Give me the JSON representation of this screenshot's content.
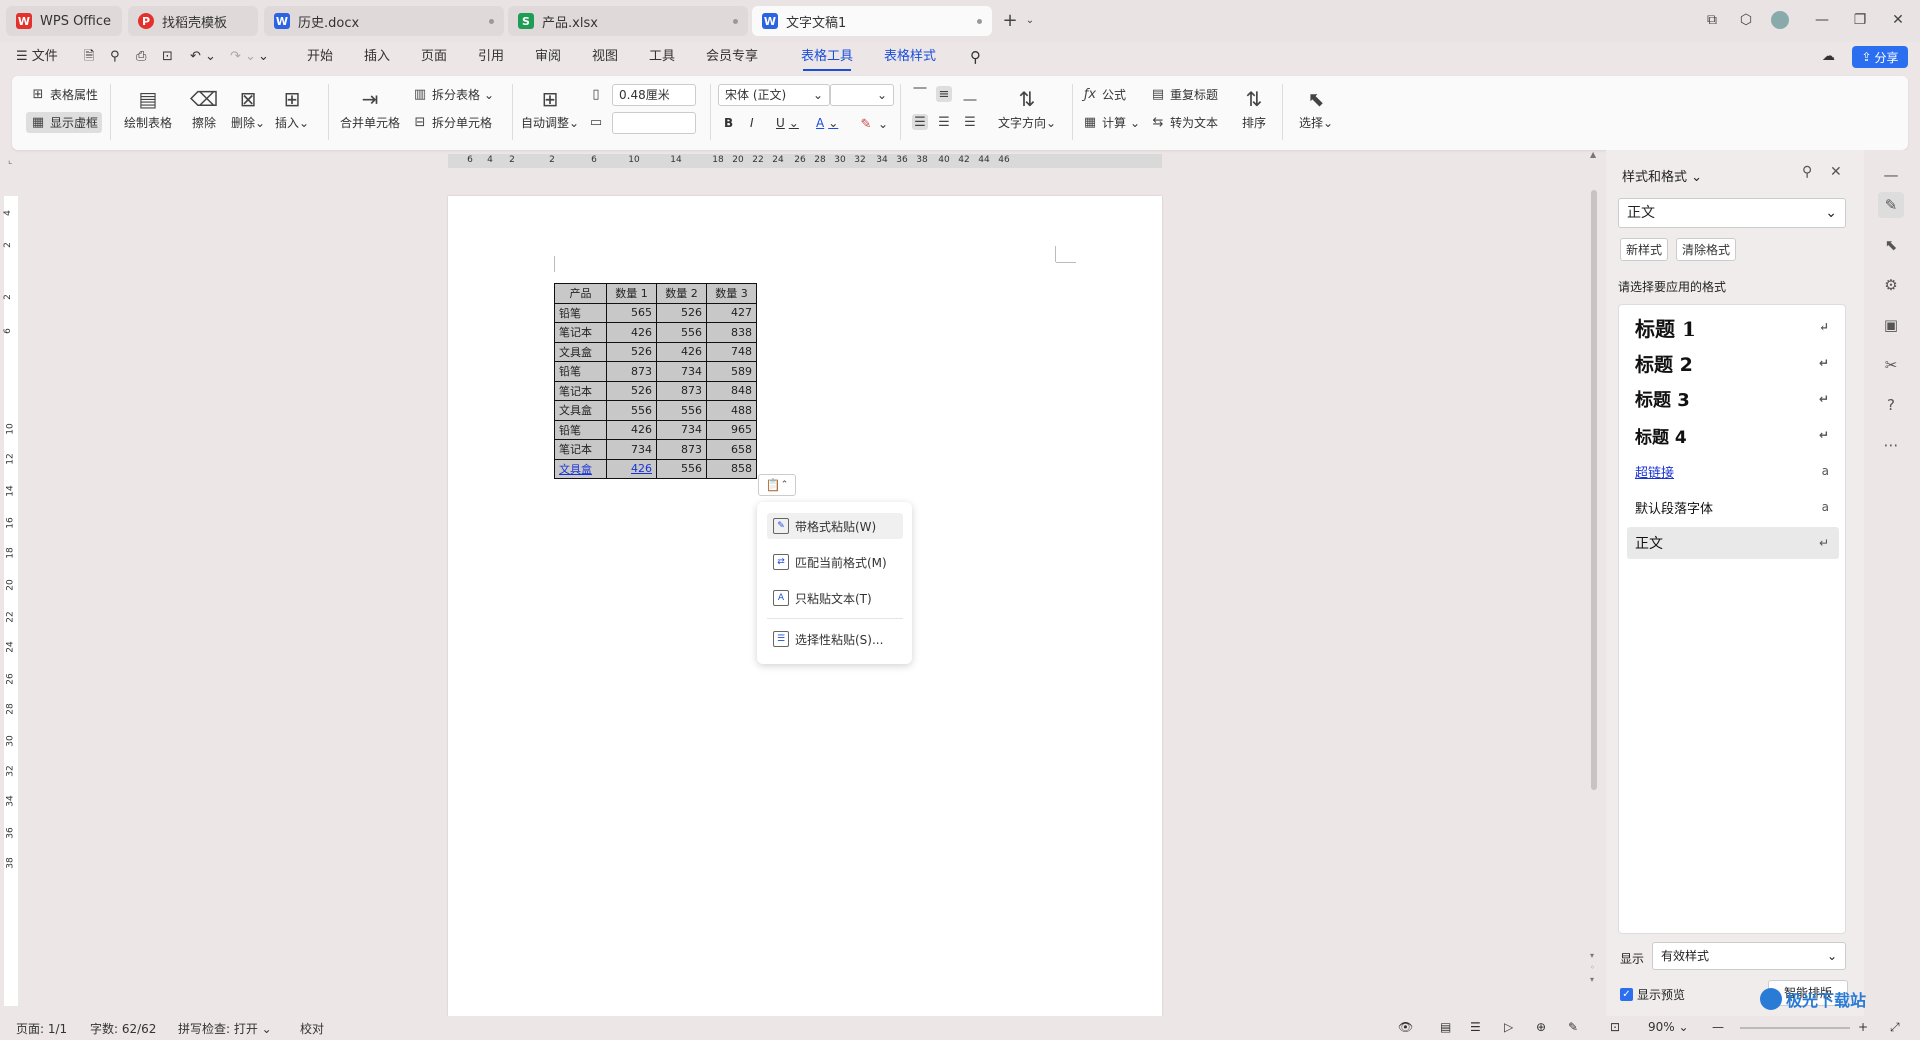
{
  "tabs": [
    {
      "label": "WPS Office",
      "logo": "W"
    },
    {
      "label": "找稻壳模板",
      "logo": "P"
    },
    {
      "label": "历史.docx",
      "logo": "W"
    },
    {
      "label": "产品.xlsx",
      "logo": "S"
    },
    {
      "label": "文字文稿1",
      "logo": "W"
    }
  ],
  "menu": {
    "file": "文件",
    "items": [
      "开始",
      "插入",
      "页面",
      "引用",
      "审阅",
      "视图",
      "工具",
      "会员专享",
      "表格工具",
      "表格样式"
    ],
    "share": "分享"
  },
  "ribbon": {
    "table_props": "表格属性",
    "show_gridlines": "显示虚框",
    "draw_table": "绘制表格",
    "erase": "擦除",
    "delete": "删除",
    "insert": "插入",
    "merge_cells": "合并单元格",
    "split_table": "拆分表格",
    "split_cells": "拆分单元格",
    "auto_fit": "自动调整",
    "cell_width": "0.48厘米",
    "cell_height": "",
    "font_name": "宋体 (正文)",
    "font_size": "",
    "bold": "B",
    "italic": "I",
    "underline": "U",
    "font_color": "A",
    "text_direction": "文字方向",
    "formula": "公式",
    "calculate": "计算",
    "repeat_header": "重复标题",
    "convert_text": "转为文本",
    "sort": "排序",
    "select": "选择"
  },
  "hruler_ticks": [
    "6",
    "4",
    "2",
    "2",
    "6",
    "10",
    "14",
    "18",
    "20",
    "22",
    "24",
    "26",
    "28",
    "30",
    "32",
    "34",
    "36",
    "38",
    "40",
    "42",
    "44",
    "46"
  ],
  "vruler_ticks": [
    "4",
    "2",
    "2",
    "6",
    "10",
    "12",
    "14",
    "16",
    "18",
    "20",
    "22",
    "24",
    "26",
    "28",
    "30",
    "32",
    "34",
    "36",
    "38"
  ],
  "table": {
    "header": [
      "产品",
      "数量 1",
      "数量 2",
      "数量 3"
    ],
    "rows": [
      [
        "铅笔",
        "565",
        "526",
        "427"
      ],
      [
        "笔记本",
        "426",
        "556",
        "838"
      ],
      [
        "文具盒",
        "526",
        "426",
        "748"
      ],
      [
        "铅笔",
        "873",
        "734",
        "589"
      ],
      [
        "笔记本",
        "526",
        "873",
        "848"
      ],
      [
        "文具盒",
        "556",
        "556",
        "488"
      ],
      [
        "铅笔",
        "426",
        "734",
        "965"
      ],
      [
        "笔记本",
        "734",
        "873",
        "658"
      ],
      [
        "文具盒",
        "426",
        "556",
        "858"
      ]
    ]
  },
  "paste_menu": {
    "keep_format": "带格式粘贴(W)",
    "match_format": "匹配当前格式(M)",
    "text_only": "只粘贴文本(T)",
    "paste_special": "选择性粘贴(S)..."
  },
  "panel": {
    "title": "样式和格式",
    "current_style": "正文",
    "new_style": "新样式",
    "clear_format": "清除格式",
    "prompt": "请选择要应用的格式",
    "styles": [
      "标题 1",
      "标题 2",
      "标题 3",
      "标题 4",
      "超链接",
      "默认段落字体",
      "正文"
    ],
    "show_label": "显示",
    "show_value": "有效样式",
    "preview_label": "显示预览",
    "smart_layout": "智能排版"
  },
  "status": {
    "page": "页面: 1/1",
    "words": "字数: 62/62",
    "spell": "拼写检查: 打开",
    "proof": "校对",
    "zoom": "90%"
  },
  "colors": {
    "accent": "#1b4ddc",
    "wps_red": "#e3322d",
    "excel_green": "#1f9d55"
  },
  "watermark": "极光下载站"
}
